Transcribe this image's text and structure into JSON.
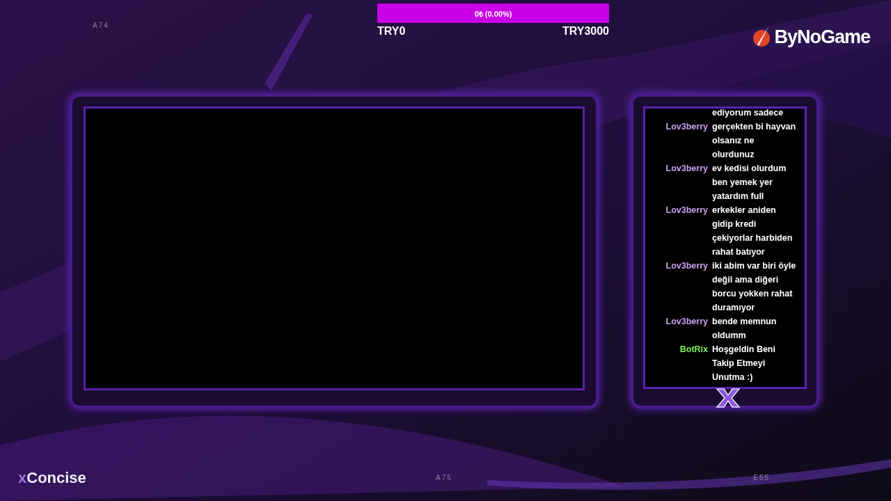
{
  "goal_bar": {
    "label": "0₺ (0.00%)",
    "min_label": "TRY0",
    "max_label": "TRY3000"
  },
  "background_marks": [
    "A74",
    "A75",
    "E55"
  ],
  "sponsor_logo": {
    "text": "ByNoGame"
  },
  "video_frame": {
    "kind": "empty"
  },
  "chat": {
    "messages": [
      {
        "text": "ediyorum sadece"
      },
      {
        "user": "Lov3berry",
        "color": "#c9a0f0",
        "text": "gerçekten bi hayvan olsanız ne olurdunuz"
      },
      {
        "user": "Lov3berry",
        "color": "#c9a0f0",
        "text": "ev kedisi olurdum ben yemek yer yatardım full"
      },
      {
        "user": "Lov3berry",
        "color": "#c9a0f0",
        "text": "erkekler aniden gidip kredi çekiyorlar harbiden rahat batıyor"
      },
      {
        "user": "Lov3berry",
        "color": "#c9a0f0",
        "text": "iki abim var biri öyle değil ama diğeri borcu yokken rahat duramıyor"
      },
      {
        "user": "Lov3berry",
        "color": "#c9a0f0",
        "text": "bende memnun oldumm"
      },
      {
        "user": "BotRix",
        "color": "#7cf05a",
        "text": "Hoşgeldin Beni Takip Etmeyi Unutma :)"
      }
    ]
  },
  "brand_logo": {
    "prefix": "x",
    "name": "Concise"
  }
}
